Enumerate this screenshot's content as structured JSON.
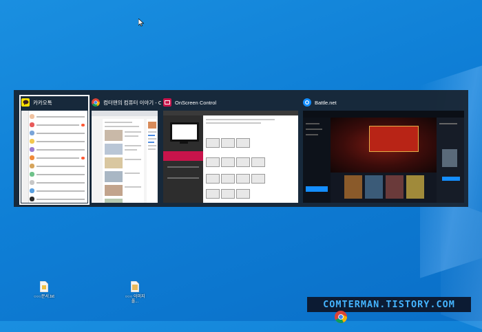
{
  "colors": {
    "desktop_bg": "#0f7fd6",
    "switcher_bg": "#18222e",
    "kakao_yellow": "#fae100",
    "onscreen_red": "#c8144b",
    "battlenet_blue": "#148eff",
    "watermark_text": "#45b4ff"
  },
  "switcher": {
    "windows": [
      {
        "app": "kakaotalk",
        "icon": "kakaotalk-icon",
        "title": "카카오톡",
        "selected": true
      },
      {
        "app": "chrome",
        "icon": "chrome-icon",
        "title": "컴터맨의 컴퓨터 이야기 - Chr...",
        "selected": false
      },
      {
        "app": "onscreen-control",
        "icon": "onscreen-control-icon",
        "title": "OnScreen Control",
        "selected": false
      },
      {
        "app": "battlenet",
        "icon": "battlenet-icon",
        "title": "Battle.net",
        "selected": false
      }
    ]
  },
  "desktop_icons": [
    {
      "name": "file-icon",
      "label": "○○○문서.txt"
    },
    {
      "name": "file-icon",
      "label": "○○○ 이미지 폴..."
    }
  ],
  "watermark": "COMTERMAN.TISTORY.COM",
  "taskbar": {
    "chrome_icon": "chrome-icon"
  }
}
